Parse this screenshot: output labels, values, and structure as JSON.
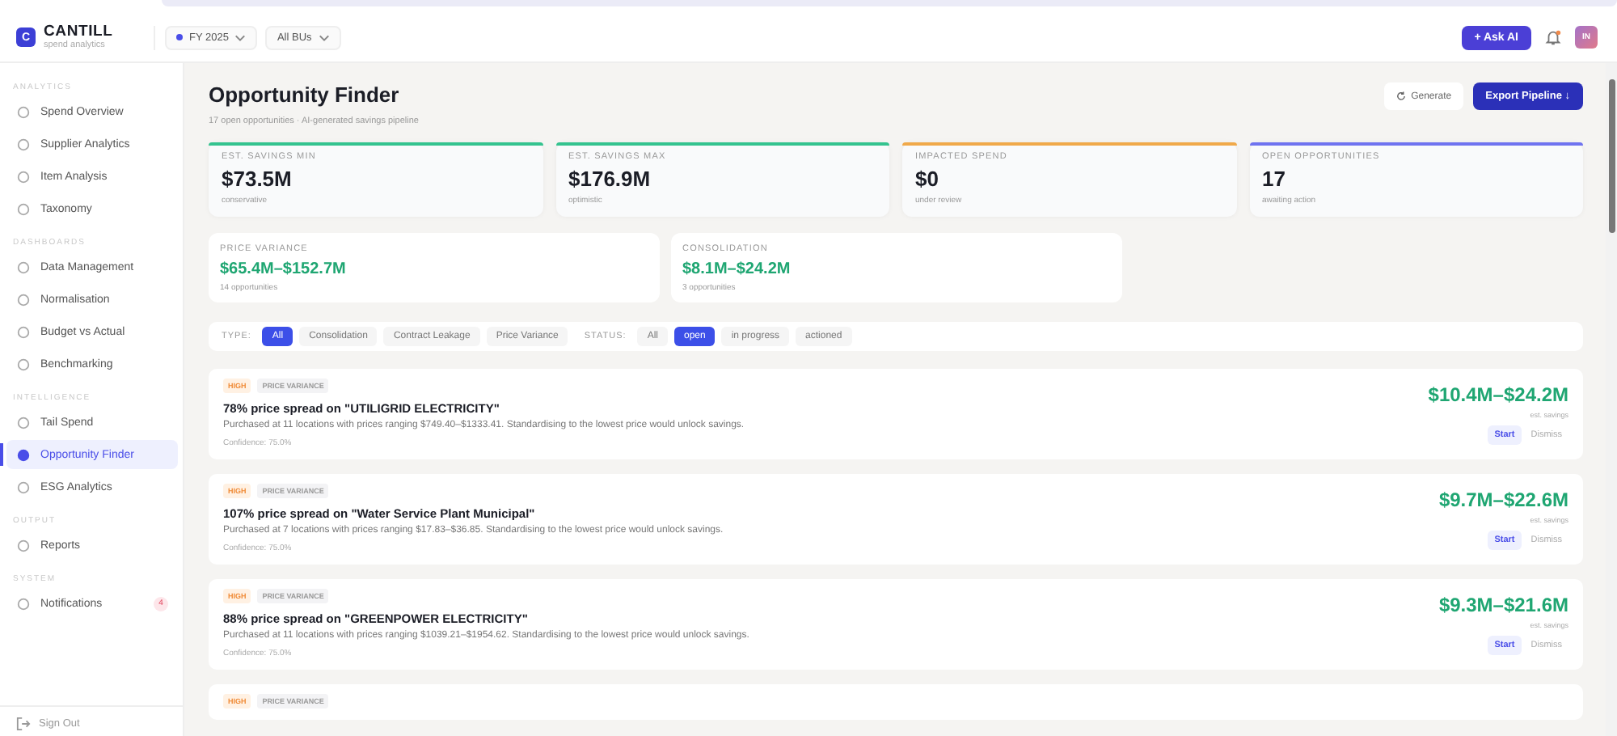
{
  "brand": {
    "name": "CANTILL",
    "tagline": "spend analytics",
    "letter": "C"
  },
  "header": {
    "filters": [
      {
        "label": "FY 2025",
        "dot": true
      },
      {
        "label": "All BUs",
        "dot": false
      }
    ],
    "ask_ai": "+ Ask AI",
    "avatar": "IN"
  },
  "sidebar": {
    "sections": [
      {
        "label": "ANALYTICS",
        "items": [
          {
            "label": "Spend Overview",
            "selected": false
          },
          {
            "label": "Supplier Analytics",
            "selected": false
          },
          {
            "label": "Item Analysis",
            "selected": false
          },
          {
            "label": "Taxonomy",
            "selected": false
          }
        ]
      },
      {
        "label": "DASHBOARDS",
        "items": [
          {
            "label": "Data Management",
            "selected": false
          },
          {
            "label": "Normalisation",
            "selected": false
          },
          {
            "label": "Budget vs Actual",
            "selected": false
          },
          {
            "label": "Benchmarking",
            "selected": false
          }
        ]
      },
      {
        "label": "INTELLIGENCE",
        "items": [
          {
            "label": "Tail Spend",
            "selected": false
          },
          {
            "label": "Opportunity Finder",
            "selected": true
          },
          {
            "label": "ESG Analytics",
            "selected": false
          }
        ]
      },
      {
        "label": "OUTPUT",
        "items": [
          {
            "label": "Reports",
            "selected": false
          }
        ]
      },
      {
        "label": "SYSTEM",
        "items": [
          {
            "label": "Notifications",
            "selected": false,
            "badge": "4"
          }
        ]
      }
    ],
    "sign_out": "Sign Out"
  },
  "page": {
    "title": "Opportunity Finder",
    "subtitle": "17 open opportunities · AI-generated savings pipeline",
    "generate": "Generate",
    "export": "Export Pipeline ↓"
  },
  "kpis": [
    {
      "label": "EST. SAVINGS MIN",
      "value": "$73.5M",
      "note": "conservative",
      "color": "#34c38f"
    },
    {
      "label": "EST. SAVINGS MAX",
      "value": "$176.9M",
      "note": "optimistic",
      "color": "#34c38f"
    },
    {
      "label": "IMPACTED SPEND",
      "value": "$0",
      "note": "under review",
      "color": "#f0a94a"
    },
    {
      "label": "OPEN OPPORTUNITIES",
      "value": "17",
      "note": "awaiting action",
      "color": "#6f73f0"
    }
  ],
  "categories": [
    {
      "label": "PRICE VARIANCE",
      "value": "$65.4M–$152.7M",
      "note": "14 opportunities"
    },
    {
      "label": "CONSOLIDATION",
      "value": "$8.1M–$24.2M",
      "note": "3 opportunities"
    }
  ],
  "filters": {
    "type_label": "TYPE:",
    "types": [
      {
        "label": "All",
        "selected": true
      },
      {
        "label": "Consolidation",
        "selected": false
      },
      {
        "label": "Contract Leakage",
        "selected": false
      },
      {
        "label": "Price Variance",
        "selected": false
      }
    ],
    "status_label": "STATUS:",
    "statuses": [
      {
        "label": "All",
        "selected": false
      },
      {
        "label": "open",
        "selected": true
      },
      {
        "label": "in progress",
        "selected": false
      },
      {
        "label": "actioned",
        "selected": false
      }
    ]
  },
  "opportunities": [
    {
      "priority": "HIGH",
      "type": "PRICE VARIANCE",
      "title": "78% price spread on \"UTILIGRID ELECTRICITY\"",
      "description": "Purchased at 11 locations with prices ranging $749.40–$1333.41. Standardising to the lowest price would unlock savings.",
      "confidence": "Confidence: 75.0%",
      "savings": "$10.4M–$24.2M",
      "savings_note": "est. savings",
      "start": "Start",
      "dismiss": "Dismiss"
    },
    {
      "priority": "HIGH",
      "type": "PRICE VARIANCE",
      "title": "107% price spread on \"Water Service Plant Municipal\"",
      "description": "Purchased at 7 locations with prices ranging $17.83–$36.85. Standardising to the lowest price would unlock savings.",
      "confidence": "Confidence: 75.0%",
      "savings": "$9.7M–$22.6M",
      "savings_note": "est. savings",
      "start": "Start",
      "dismiss": "Dismiss"
    },
    {
      "priority": "HIGH",
      "type": "PRICE VARIANCE",
      "title": "88% price spread on \"GREENPOWER ELECTRICITY\"",
      "description": "Purchased at 11 locations with prices ranging $1039.21–$1954.62. Standardising to the lowest price would unlock savings.",
      "confidence": "Confidence: 75.0%",
      "savings": "$9.3M–$21.6M",
      "savings_note": "est. savings",
      "start": "Start",
      "dismiss": "Dismiss"
    },
    {
      "priority": "HIGH",
      "type": "PRICE VARIANCE"
    }
  ]
}
